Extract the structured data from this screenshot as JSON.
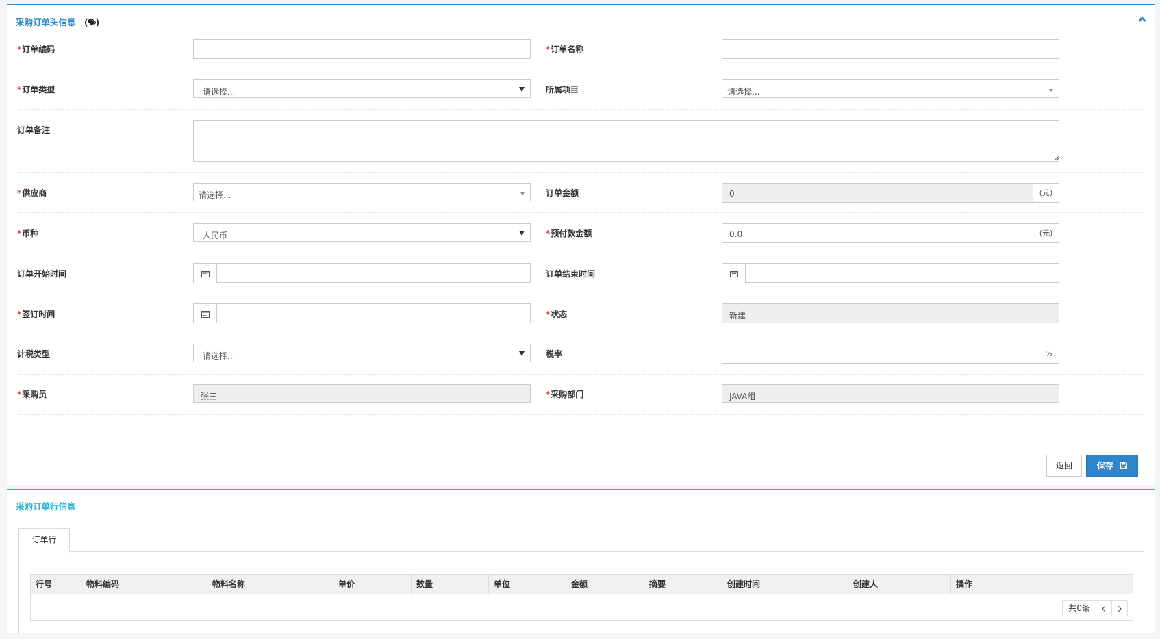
{
  "header_panel": {
    "title": "采购订单头信息",
    "fields": {
      "order_code": {
        "label": "订单编码",
        "value": ""
      },
      "order_name": {
        "label": "订单名称",
        "value": ""
      },
      "order_type": {
        "label": "订单类型",
        "placeholder": "请选择..."
      },
      "project": {
        "label": "所属项目",
        "placeholder": "请选择..."
      },
      "remark": {
        "label": "订单备注",
        "value": ""
      },
      "supplier": {
        "label": "供应商",
        "placeholder": "请选择..."
      },
      "order_amount": {
        "label": "订单金额",
        "value": "0",
        "unit": "(元)"
      },
      "currency": {
        "label": "币种",
        "value": "人民币"
      },
      "prepay_amount": {
        "label": "预付款金额",
        "value": "0.0",
        "unit": "(元)"
      },
      "start_time": {
        "label": "订单开始时间",
        "value": ""
      },
      "end_time": {
        "label": "订单结束时间",
        "value": ""
      },
      "sign_time": {
        "label": "签订时间",
        "value": ""
      },
      "status": {
        "label": "状态",
        "value": "新建"
      },
      "tax_type": {
        "label": "计税类型",
        "placeholder": "请选择..."
      },
      "tax_rate": {
        "label": "税率",
        "value": "",
        "unit": "%"
      },
      "buyer": {
        "label": "采购员",
        "value": "张三"
      },
      "department": {
        "label": "采购部门",
        "value": "JAVA组"
      }
    },
    "buttons": {
      "back": "返回",
      "save": "保存"
    }
  },
  "lines_panel": {
    "title": "采购订单行信息",
    "tabs": [
      {
        "label": "订单行",
        "active": true
      }
    ],
    "columns": [
      "行号",
      "物料编码",
      "物料名称",
      "单价",
      "数量",
      "单位",
      "金额",
      "摘要",
      "创建时间",
      "创建人",
      "操作"
    ],
    "rows": [],
    "pager": {
      "total": "共0条"
    }
  },
  "colors": {
    "primary": "#2d85cd",
    "secondary_accent": "#2bb6d6",
    "required": "#d9534f",
    "readonly_bg": "#eceef0"
  }
}
